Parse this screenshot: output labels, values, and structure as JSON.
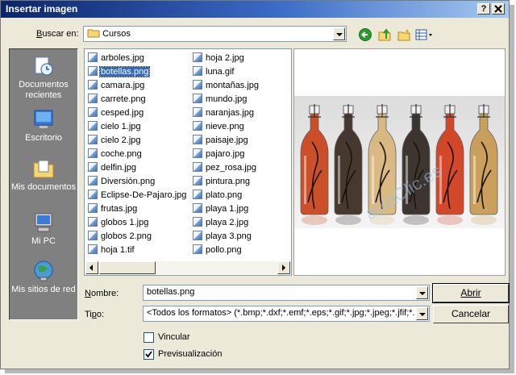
{
  "window": {
    "title": "Insertar imagen",
    "help_button": "?",
    "close_button": "X"
  },
  "lookin": {
    "label": "Buscar en:",
    "value": "Cursos"
  },
  "toolbar": {
    "back_icon": "back-arrow-icon",
    "up_icon": "up-folder-icon",
    "newfolder_icon": "new-folder-icon",
    "views_icon": "views-menu-icon"
  },
  "places": [
    {
      "label": "Documentos recientes",
      "icon": "recent-documents-icon"
    },
    {
      "label": "Escritorio",
      "icon": "desktop-icon"
    },
    {
      "label": "Mis documentos",
      "icon": "my-documents-icon"
    },
    {
      "label": "Mi PC",
      "icon": "my-computer-icon"
    },
    {
      "label": "Mis sitios de red",
      "icon": "network-places-icon"
    }
  ],
  "files_col1": [
    "arboles.jpg",
    "botellas.png",
    "camara.jpg",
    "carrete.png",
    "cesped.jpg",
    "cielo 1.jpg",
    "cielo 2.jpg",
    "coche.png",
    "delfin.jpg",
    "Diversión.png",
    "Eclipse-De-Pajaro.jpg",
    "frutas.jpg",
    "globos 1.jpg",
    "globos 2.png",
    "hoja 1.tif"
  ],
  "files_col2": [
    "hoja 2.jpg",
    "luna.gif",
    "montañas.jpg",
    "mundo.jpg",
    "naranjas.jpg",
    "nieve.png",
    "paisaje.jpg",
    "pajaro.jpg",
    "pez_rosa.jpg",
    "pintura.png",
    "plato.png",
    "playa 1.jpg",
    "playa 2.jpg",
    "playa 3.png",
    "pollo.png"
  ],
  "selected_file": "botellas.png",
  "filename": {
    "label": "Nombre:",
    "value": "botellas.png"
  },
  "filetype": {
    "label": "Tipo:",
    "value": "<Todos los formatos> (*.bmp;*.dxf;*.emf;*.eps;*.gif;*.jpg;*.jpeg;*.jfif;*.jif;*."
  },
  "buttons": {
    "open": "Abrir",
    "cancel": "Cancelar"
  },
  "options": {
    "link": {
      "label": "Vincular",
      "checked": false
    },
    "preview": {
      "label": "Previsualización",
      "checked": true
    }
  },
  "watermark": "aulaClic.es",
  "colors": {
    "places_bg": "#808080",
    "dialog_bg": "#ece9d8",
    "selection": "#316ac5",
    "title_start": "#0a246a"
  }
}
